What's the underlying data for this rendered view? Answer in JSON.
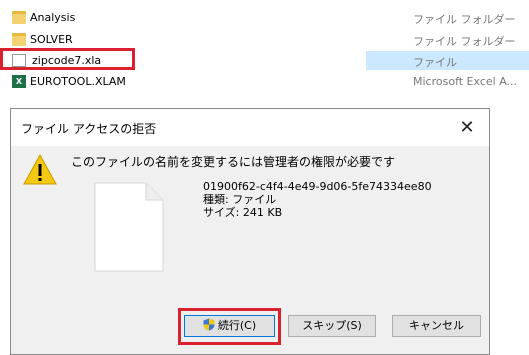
{
  "file_list": [
    {
      "name": "Analysis",
      "type": "ファイル フォルダー",
      "icon": "folder-icon"
    },
    {
      "name": "SOLVER",
      "type": "ファイル フォルダー",
      "icon": "folder-icon"
    },
    {
      "name": "zipcode7.xla",
      "type": "ファイル",
      "icon": "file-icon",
      "selected": true
    },
    {
      "name": "EUROTOOL.XLAM",
      "type": "Microsoft Excel A...",
      "icon": "excel-icon"
    }
  ],
  "dialog": {
    "title": "ファイル アクセスの拒否",
    "message": "このファイルの名前を変更するには管理者の権限が必要です",
    "file_name": "01900f62-c4f4-4e49-9d06-5fe74334ee80",
    "file_type": "種類: ファイル",
    "file_size": "サイズ: 241 KB",
    "buttons": {
      "continue": "続行(C)",
      "skip": "スキップ(S)",
      "cancel": "キャンセル"
    }
  },
  "colors": {
    "highlight": "#d9222e",
    "selection": "#cce8ff",
    "dialog_bg": "#f0f0f0",
    "accent": "#0078d7"
  }
}
